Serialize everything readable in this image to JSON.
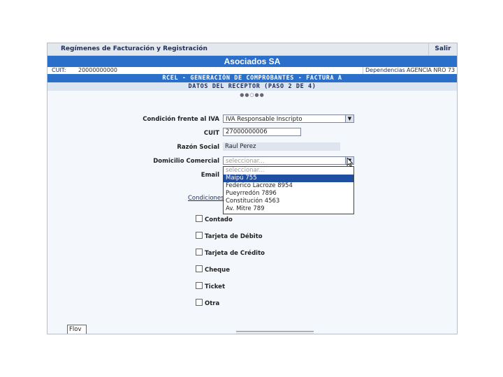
{
  "header": {
    "title": "Regímenes de Facturación y Registración",
    "exit_label": "Salir"
  },
  "company_name": "Asociados SA",
  "info_row": {
    "cuit_label": "CUIT:",
    "cuit_value": "20000000000",
    "dep_label": "Dependencias",
    "dep_value": "AGENCIA NRO 73"
  },
  "band_title": "RCEL - GENERACIÓN DE COMPROBANTES - FACTURA A",
  "band_subtitle": "DATOS DEL RECEPTOR (PASO 2 DE 4)",
  "progress_dots": "●●○●●",
  "form": {
    "iva_label": "Condición frente al IVA",
    "iva_value": "IVA Responsable Inscripto",
    "cuit_label": "CUIT",
    "cuit_value": "27000000006",
    "razon_label": "Razón Social",
    "razon_value": "Raul Perez",
    "domicilio_label": "Domicilio Comercial",
    "domicilio_value": "seleccionar...",
    "email_label": "Email"
  },
  "dropdown_options": [
    "seleccionar...",
    "Maipú 755",
    "Federico Lacroze 8954",
    "Pueyrredón 7896",
    "Constitución 4563",
    "Av. Mitre 789"
  ],
  "conditions": {
    "title": "Condiciones",
    "options": [
      "Contado",
      "Tarjeta de Débito",
      "Tarjeta de Crédito",
      "Cheque",
      "Ticket",
      "Otra"
    ]
  },
  "footer": {
    "flow_label": "Flov"
  }
}
